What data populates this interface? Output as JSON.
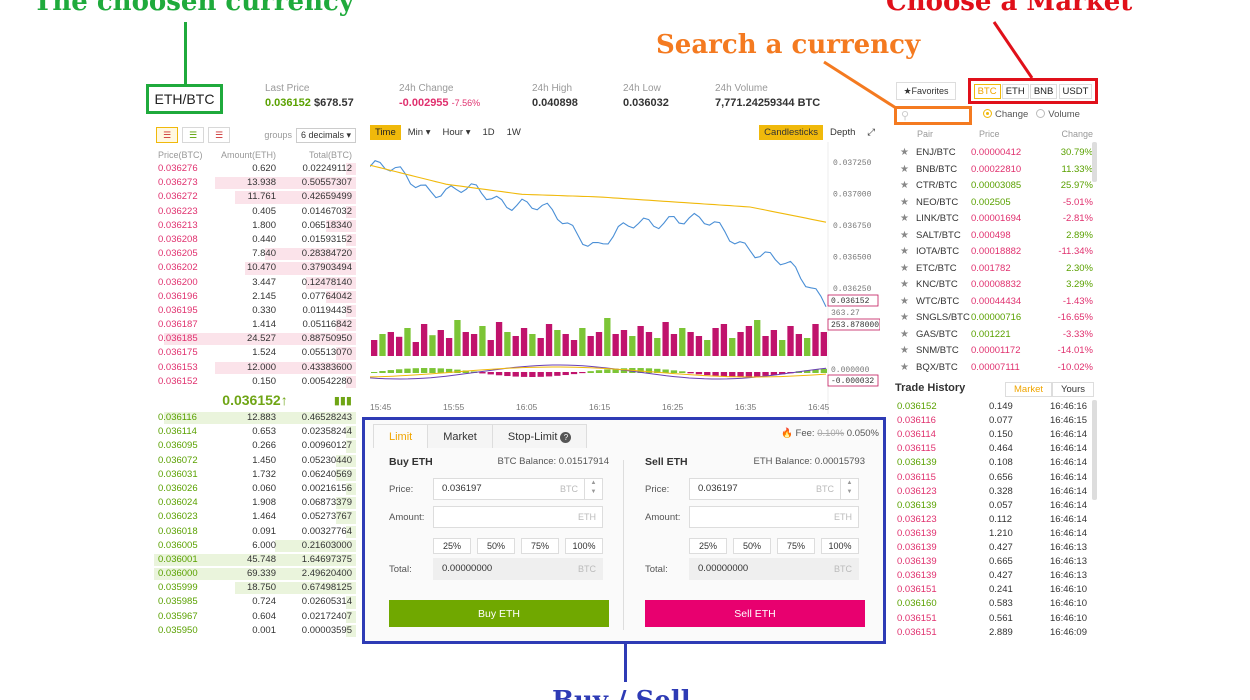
{
  "annotations": {
    "chosen_currency": "The choosen currency",
    "choose_market": "Choose a Market",
    "search_currency": "Search a currency",
    "buy_sell": "Buy / Sell"
  },
  "ticker": {
    "pair": "ETH/BTC",
    "last_price_label": "Last Price",
    "last_price": "0.036152",
    "last_price_usd": "$678.57",
    "change_label": "24h Change",
    "change": "-0.002955",
    "change_pct": "-7.56%",
    "high_label": "24h High",
    "high": "0.040898",
    "low_label": "24h Low",
    "low": "0.036032",
    "volume_label": "24h Volume",
    "volume": "7,771.24259344 BTC"
  },
  "orderbook": {
    "groups_label": "groups",
    "groups_value": "6 decimals ▾",
    "headers": [
      "Price(BTC)",
      "Amount(ETH)",
      "Total(BTC)"
    ],
    "asks": [
      [
        "0.036276",
        "0.620",
        "0.02249112"
      ],
      [
        "0.036273",
        "13.938",
        "0.50557307"
      ],
      [
        "0.036272",
        "11.761",
        "0.42659499"
      ],
      [
        "0.036223",
        "0.405",
        "0.01467032"
      ],
      [
        "0.036213",
        "1.800",
        "0.06518340"
      ],
      [
        "0.036208",
        "0.440",
        "0.01593152"
      ],
      [
        "0.036205",
        "7.840",
        "0.28384720"
      ],
      [
        "0.036202",
        "10.470",
        "0.37903494"
      ],
      [
        "0.036200",
        "3.447",
        "0.12478140"
      ],
      [
        "0.036196",
        "2.145",
        "0.07764042"
      ],
      [
        "0.036195",
        "0.330",
        "0.01194435"
      ],
      [
        "0.036187",
        "1.414",
        "0.05116842"
      ],
      [
        "0.036185",
        "24.527",
        "0.88750950"
      ],
      [
        "0.036175",
        "1.524",
        "0.05513070"
      ],
      [
        "0.036153",
        "12.000",
        "0.43383600"
      ],
      [
        "0.036152",
        "0.150",
        "0.00542280"
      ]
    ],
    "ask_depth": [
      0.05,
      0.7,
      0.6,
      0.05,
      0.15,
      0.05,
      0.45,
      0.55,
      0.25,
      0.15,
      0.05,
      0.1,
      0.95,
      0.1,
      0.7,
      0.05
    ],
    "mid_price": "0.036152↑",
    "bids": [
      [
        "0.036116",
        "12.883",
        "0.46528243"
      ],
      [
        "0.036114",
        "0.653",
        "0.02358244"
      ],
      [
        "0.036095",
        "0.266",
        "0.00960127"
      ],
      [
        "0.036072",
        "1.450",
        "0.05230440"
      ],
      [
        "0.036031",
        "1.732",
        "0.06240569"
      ],
      [
        "0.036026",
        "0.060",
        "0.00216156"
      ],
      [
        "0.036024",
        "1.908",
        "0.06873379"
      ],
      [
        "0.036023",
        "1.464",
        "0.05273767"
      ],
      [
        "0.036018",
        "0.091",
        "0.00327764"
      ],
      [
        "0.036005",
        "6.000",
        "0.21603000"
      ],
      [
        "0.036001",
        "45.748",
        "1.64697375"
      ],
      [
        "0.036000",
        "69.339",
        "2.49620400"
      ],
      [
        "0.035999",
        "18.750",
        "0.67498125"
      ],
      [
        "0.035985",
        "0.724",
        "0.02605314"
      ],
      [
        "0.035967",
        "0.604",
        "0.02172407"
      ],
      [
        "0.035950",
        "0.001",
        "0.00003595"
      ]
    ],
    "bid_depth": [
      0.95,
      0.05,
      0.05,
      0.1,
      0.1,
      0.05,
      0.1,
      0.1,
      0.05,
      0.4,
      1.0,
      1.0,
      0.6,
      0.05,
      0.05,
      0.05
    ]
  },
  "chart": {
    "intervals": [
      "Time",
      "Min ▾",
      "Hour ▾",
      "1D",
      "1W"
    ],
    "candlesticks_label": "Candlesticks",
    "depth_label": "Depth",
    "price_ticks": [
      "0.037250",
      "0.037000",
      "0.036750",
      "0.036500",
      "0.036250"
    ],
    "current_price_tag": "0.036152",
    "volume_value": "363.27",
    "volume_tag": "253.878000",
    "macd_value": "0.000000",
    "macd_tag": "-0.000032",
    "time_ticks": [
      "15:45",
      "15:55",
      "16:05",
      "16:15",
      "16:25",
      "16:35",
      "16:45"
    ]
  },
  "chart_data": {
    "type": "line",
    "x": [
      "15:45",
      "15:55",
      "16:05",
      "16:15",
      "16:25",
      "16:35",
      "16:45"
    ],
    "ylim": [
      0.0361,
      0.0373
    ],
    "series": [
      {
        "values": [
          0.03717,
          0.03698,
          0.0369,
          0.03657,
          0.0368,
          0.03656,
          0.03614
        ]
      },
      {
        "values": [
          0.03718,
          0.03703,
          0.03695,
          0.03693,
          0.03689,
          0.03685,
          0.03673
        ]
      }
    ],
    "volume": [
      40,
      55,
      60,
      48,
      70,
      35,
      80,
      52,
      65,
      45,
      90,
      60,
      55,
      75,
      40,
      85,
      60,
      50,
      70,
      55,
      45,
      80,
      65,
      55,
      40,
      70,
      50,
      60,
      95,
      55,
      65,
      50,
      75,
      60,
      45,
      85,
      55,
      70,
      60,
      50,
      40,
      70,
      80,
      45,
      60,
      75,
      90,
      50,
      65,
      40,
      75,
      55,
      45,
      80,
      60
    ]
  },
  "trade": {
    "tabs": [
      "Limit",
      "Market",
      "Stop-Limit"
    ],
    "fee_label": "Fee:",
    "fee_old": "0.10%",
    "fee_new": "0.050%",
    "buy": {
      "title": "Buy ETH",
      "balance": "BTC Balance: 0.01517914",
      "price_label": "Price:",
      "price": "0.036197",
      "price_unit": "BTC",
      "amount_label": "Amount:",
      "amount_unit": "ETH",
      "total_label": "Total:",
      "total": "0.00000000",
      "total_unit": "BTC",
      "button": "Buy ETH"
    },
    "sell": {
      "title": "Sell ETH",
      "balance": "ETH Balance: 0.00015793",
      "price_label": "Price:",
      "price": "0.036197",
      "price_unit": "BTC",
      "amount_label": "Amount:",
      "amount_unit": "ETH",
      "total_label": "Total:",
      "total": "0.00000000",
      "total_unit": "BTC",
      "button": "Sell ETH"
    },
    "percents": [
      "25%",
      "50%",
      "75%",
      "100%"
    ]
  },
  "markets": {
    "favorites": "★Favorites",
    "tabs": [
      "BTC",
      "ETH",
      "BNB",
      "USDT"
    ],
    "change_radio": "Change",
    "volume_radio": "Volume",
    "headers": [
      "Pair",
      "Price",
      "Change"
    ],
    "pairs": [
      [
        "ENJ/BTC",
        "0.00000412",
        "30.79%"
      ],
      [
        "BNB/BTC",
        "0.00022810",
        "11.33%"
      ],
      [
        "CTR/BTC",
        "0.00003085",
        "25.97%"
      ],
      [
        "NEO/BTC",
        "0.002505",
        "-5.01%"
      ],
      [
        "LINK/BTC",
        "0.00001694",
        "-2.81%"
      ],
      [
        "SALT/BTC",
        "0.000498",
        "2.89%"
      ],
      [
        "IOTA/BTC",
        "0.00018882",
        "-11.34%"
      ],
      [
        "ETC/BTC",
        "0.001782",
        "2.30%"
      ],
      [
        "KNC/BTC",
        "0.00008832",
        "3.29%"
      ],
      [
        "WTC/BTC",
        "0.00044434",
        "-1.43%"
      ],
      [
        "SNGLS/BTC",
        "0.00000716",
        "-16.65%"
      ],
      [
        "GAS/BTC",
        "0.001221",
        "-3.33%"
      ],
      [
        "SNM/BTC",
        "0.00001172",
        "-14.01%"
      ],
      [
        "BQX/BTC",
        "0.00007111",
        "-10.02%"
      ]
    ],
    "price_colors": [
      "red",
      "red",
      "grn",
      "grn",
      "red",
      "red",
      "red",
      "red",
      "red",
      "red",
      "grn",
      "grn",
      "red",
      "red"
    ]
  },
  "trade_history": {
    "title": "Trade History",
    "tabs": [
      "Market",
      "Yours"
    ],
    "rows": [
      [
        "0.036152",
        "0.149",
        "16:46:16",
        "grn"
      ],
      [
        "0.036116",
        "0.077",
        "16:46:15",
        "red"
      ],
      [
        "0.036114",
        "0.150",
        "16:46:14",
        "red"
      ],
      [
        "0.036115",
        "0.464",
        "16:46:14",
        "red"
      ],
      [
        "0.036139",
        "0.108",
        "16:46:14",
        "grn"
      ],
      [
        "0.036115",
        "0.656",
        "16:46:14",
        "red"
      ],
      [
        "0.036123",
        "0.328",
        "16:46:14",
        "red"
      ],
      [
        "0.036139",
        "0.057",
        "16:46:14",
        "grn"
      ],
      [
        "0.036123",
        "0.112",
        "16:46:14",
        "red"
      ],
      [
        "0.036139",
        "1.210",
        "16:46:14",
        "red"
      ],
      [
        "0.036139",
        "0.427",
        "16:46:13",
        "red"
      ],
      [
        "0.036139",
        "0.665",
        "16:46:13",
        "red"
      ],
      [
        "0.036139",
        "0.427",
        "16:46:13",
        "red"
      ],
      [
        "0.036151",
        "0.241",
        "16:46:10",
        "red"
      ],
      [
        "0.036160",
        "0.583",
        "16:46:10",
        "grn"
      ],
      [
        "0.036151",
        "0.561",
        "16:46:10",
        "red"
      ],
      [
        "0.036151",
        "2.889",
        "16:46:09",
        "red"
      ]
    ]
  },
  "colors": {
    "accent": "#f0b90b",
    "buy": "#70a800",
    "sell": "#e8006f",
    "anno_green": "#1faa3c",
    "anno_red": "#e0101a",
    "anno_orange": "#f47a20",
    "anno_blue": "#2e3bb5"
  }
}
